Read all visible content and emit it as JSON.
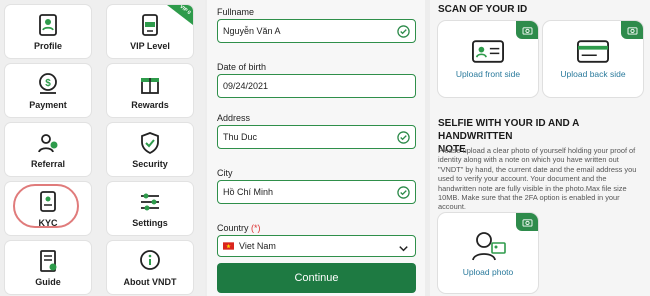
{
  "menu": {
    "profile": "Profile",
    "vip_level": "VIP Level",
    "vip_badge": "VIP 0",
    "payment": "Payment",
    "rewards": "Rewards",
    "referral": "Referral",
    "security": "Security",
    "kyc": "KYC",
    "settings": "Settings",
    "guide": "Guide",
    "about": "About VNDT"
  },
  "form": {
    "fullname_label": "Fullname",
    "fullname_value": "Nguyễn Văn A",
    "dob_label": "Date of birth",
    "dob_value": "09/24/2021",
    "address_label": "Address",
    "address_value": "Thu Duc",
    "city_label": "City",
    "city_value": "Hồ Chí Minh",
    "country_label": "Country",
    "country_required": "(*)",
    "country_value": "Viet Nam",
    "continue_label": "Continue"
  },
  "kyc_upload": {
    "scan_title": "SCAN OF YOUR ID",
    "front_label": "Upload front side",
    "back_label": "Upload back side",
    "selfie_title_line1": "SELFIE WITH YOUR ID AND A HANDWRITTEN",
    "selfie_title_line2": "NOTE",
    "description": "Please upload a clear photo of yourself holding your proof of identity along with a note on which you have written out \"VNDT\" by hand, the current date and the email address you used to verify your account. Your document and the handwritten note are fully visible in the photo.Max file size 10MB. Make sure that the 2FA option is enabled in your account.",
    "photo_label": "Upload photo"
  },
  "colors": {
    "accent": "#1e7a42",
    "kyc_highlight": "#e07b7b",
    "link": "#2a7a9c"
  }
}
